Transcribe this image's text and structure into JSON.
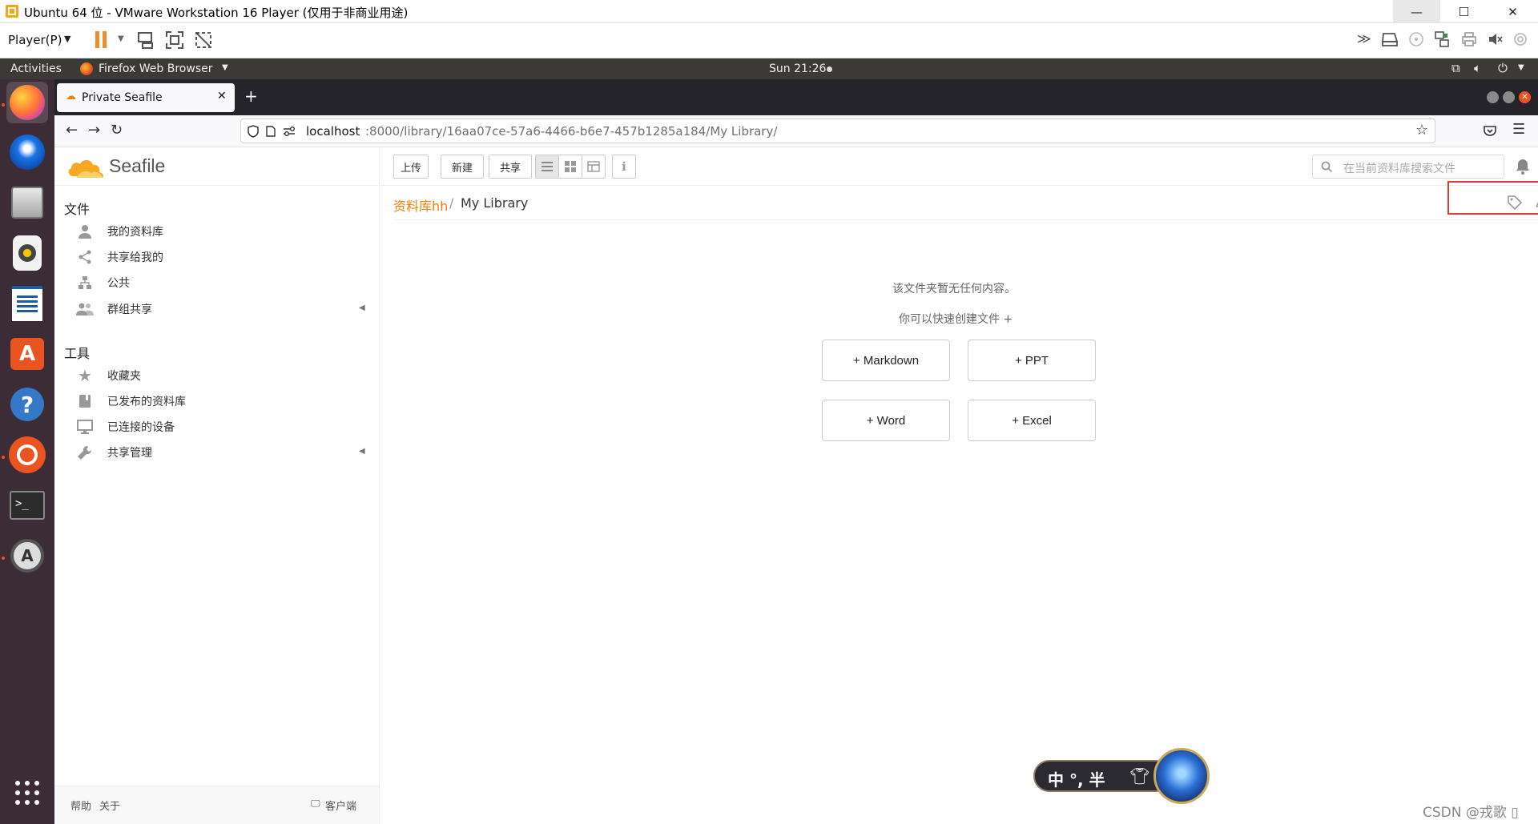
{
  "vmware": {
    "title": "Ubuntu 64 位 - VMware Workstation 16 Player (仅用于非商业用途)",
    "player_menu": "Player(P)"
  },
  "ubuntu_bar": {
    "activities": "Activities",
    "app_name": "Firefox Web Browser",
    "clock": "Sun 21:26"
  },
  "browser": {
    "tab_title": "Private Seafile",
    "url_host": "localhost",
    "url_path": ":8000/library/16aa07ce-57a6-4466-b6e7-457b1285a184/My Library/"
  },
  "seafile": {
    "logo_text": "Seafile",
    "toolbar": {
      "upload": "上传",
      "new": "新建",
      "share": "共享"
    },
    "search_placeholder": "在当前资料库搜索文件",
    "breadcrumb": {
      "library": "资料库hh",
      "sep": "/",
      "current": "My Library"
    },
    "sidebar": {
      "files_heading": "文件",
      "files_items": [
        {
          "label": "我的资料库",
          "icon": "person-icon"
        },
        {
          "label": "共享给我的",
          "icon": "share-icon"
        },
        {
          "label": "公共",
          "icon": "org-icon"
        },
        {
          "label": "群组共享",
          "icon": "group-icon"
        }
      ],
      "tools_heading": "工具",
      "tools_items": [
        {
          "label": "收藏夹",
          "icon": "star-icon"
        },
        {
          "label": "已发布的资料库",
          "icon": "book-icon"
        },
        {
          "label": "已连接的设备",
          "icon": "monitor-icon"
        },
        {
          "label": "共享管理",
          "icon": "wrench-icon"
        }
      ],
      "footer": {
        "help": "帮助",
        "about": "关于",
        "client": "客户端"
      }
    },
    "empty": {
      "message": "该文件夹暂无任何内容。",
      "hint": "你可以快速创建文件 +",
      "buttons": [
        "+ Markdown",
        "+ PPT",
        "+ Word",
        "+ Excel"
      ]
    }
  },
  "ime": {
    "text": "中 °, 半 "
  },
  "watermark": "CSDN @戎歌 ▯",
  "colors": {
    "accent": "#eb8205",
    "highlight_box": "#e0393a",
    "dock": "#3c2c36",
    "topbar": "#3b3a37"
  }
}
